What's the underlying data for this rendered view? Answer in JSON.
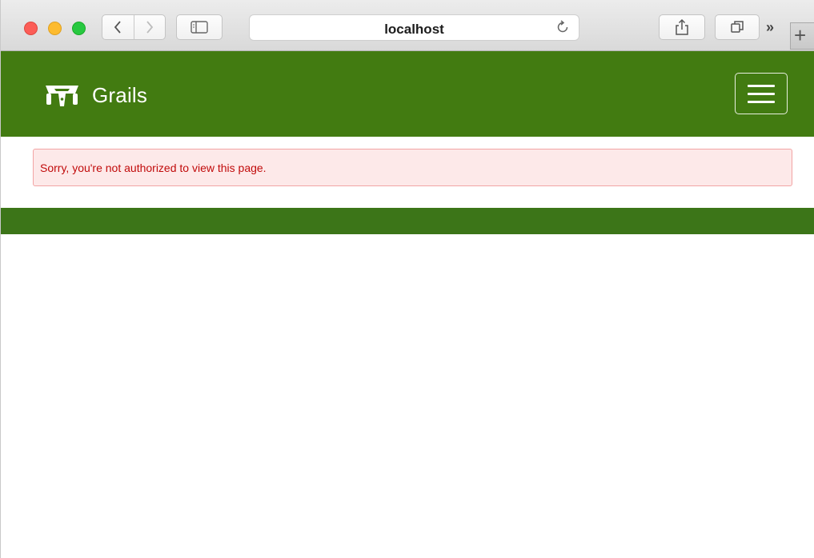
{
  "browser": {
    "url": "localhost",
    "icons": {
      "back": "chevron-left-icon",
      "forward": "chevron-right-icon",
      "sidebar": "sidebar-icon",
      "reload": "reload-icon",
      "share": "share-icon",
      "tabs": "tabs-overview-icon",
      "more": "double-chevron-icon",
      "new_tab": "plus-icon"
    },
    "more_label": "»",
    "new_tab_label": "+"
  },
  "navbar": {
    "brand": "Grails",
    "color": "#427b11",
    "menu_icon": "hamburger-icon"
  },
  "alert": {
    "message": "Sorry, you're not authorized to view this page.",
    "text_color": "#c10b0b",
    "background": "#fde9e9"
  },
  "footer": {
    "color": "#3c7518"
  }
}
